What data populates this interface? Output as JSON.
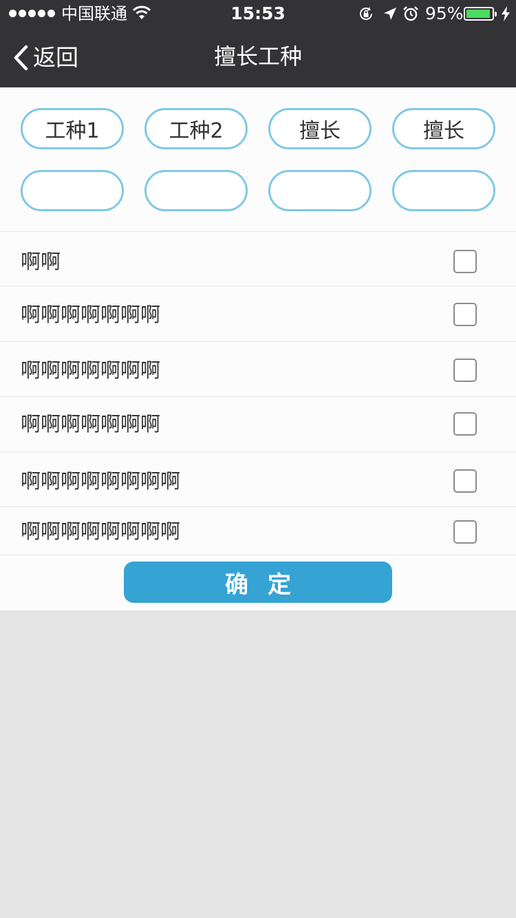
{
  "status_bar": {
    "carrier": "中国联通",
    "time": "15:53",
    "battery_percent": "95%",
    "battery_level": 0.95,
    "icons": [
      "signal-dots-icon",
      "wifi-icon",
      "rotation-lock-icon",
      "location-arrow-icon",
      "alarm-icon",
      "battery-icon",
      "charging-bolt-icon"
    ]
  },
  "nav": {
    "back_label": "返回",
    "title": "擅长工种"
  },
  "tags": [
    {
      "label": "工种1"
    },
    {
      "label": "工种2"
    },
    {
      "label": "擅长"
    },
    {
      "label": "擅长"
    },
    {
      "label": ""
    },
    {
      "label": ""
    },
    {
      "label": ""
    },
    {
      "label": ""
    }
  ],
  "items": [
    {
      "label": "啊啊",
      "checked": false
    },
    {
      "label": "啊啊啊啊啊啊啊",
      "checked": false
    },
    {
      "label": "啊啊啊啊啊啊啊",
      "checked": false
    },
    {
      "label": "啊啊啊啊啊啊啊",
      "checked": false
    },
    {
      "label": "啊啊啊啊啊啊啊啊",
      "checked": false
    },
    {
      "label": "啊啊啊啊啊啊啊啊",
      "checked": false
    }
  ],
  "confirm_label": "确定",
  "colors": {
    "nav_background": "#333336",
    "tag_border": "#80c9e5",
    "confirm_background": "#35a3d4",
    "battery_fill": "#4cd964",
    "page_background": "#e4e4e4"
  }
}
